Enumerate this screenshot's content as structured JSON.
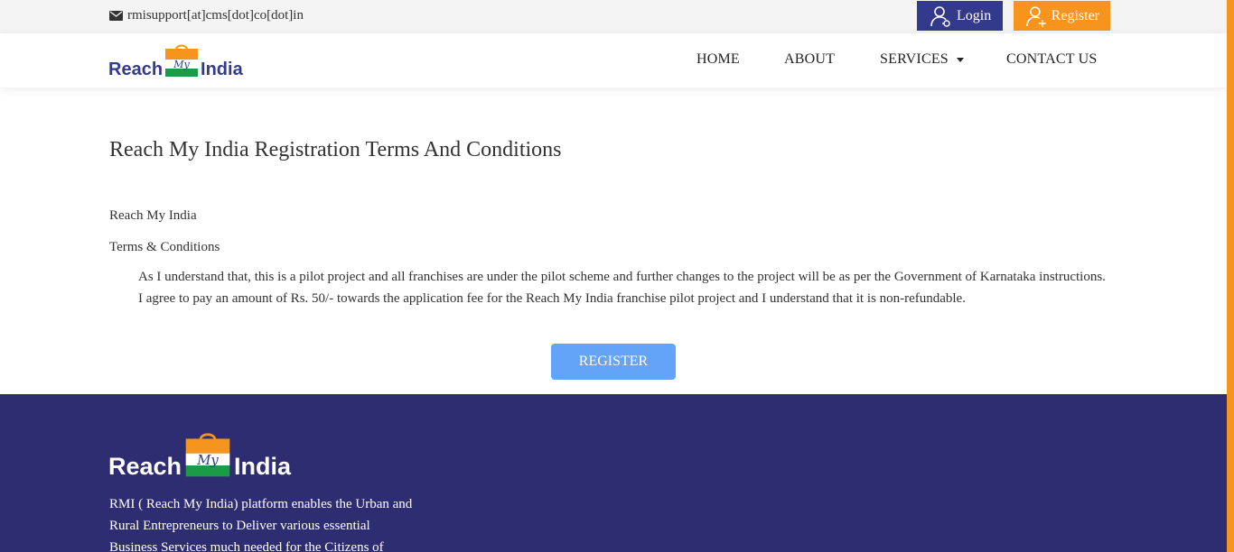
{
  "topbar": {
    "email": "rmisupport[at]cms[dot]co[dot]in",
    "login_label": "Login",
    "register_label": "Register"
  },
  "brand": {
    "word_left": "Reach",
    "word_mid": "My",
    "word_right": "India"
  },
  "nav": {
    "home": "HOME",
    "about": "ABOUT",
    "services": "SERVICES",
    "contact": "CONTACT US"
  },
  "main": {
    "title": "Reach My India Registration Terms And Conditions",
    "org": "Reach My India",
    "terms_heading": "Terms & Conditions",
    "terms": [
      "As I understand that, this is a pilot project and all franchises are under the pilot scheme and further changes to the project will be as per the Government of Karnataka instructions.",
      "I agree to pay an amount of Rs. 50/- towards the application fee for the Reach My India franchise pilot project and I understand that it is non-refundable."
    ],
    "register_button": "REGISTER"
  },
  "footer": {
    "description": "RMI ( Reach My India) platform enables the Urban and Rural Entrepreneurs to Deliver various essential Business Services much needed for the Citizens of"
  },
  "colors": {
    "brand_blue": "#343a8b",
    "brand_orange": "#f7941d",
    "brand_green": "#1a9b48",
    "footer_bg": "#2f2d71",
    "register_button": "#63a3f8"
  }
}
